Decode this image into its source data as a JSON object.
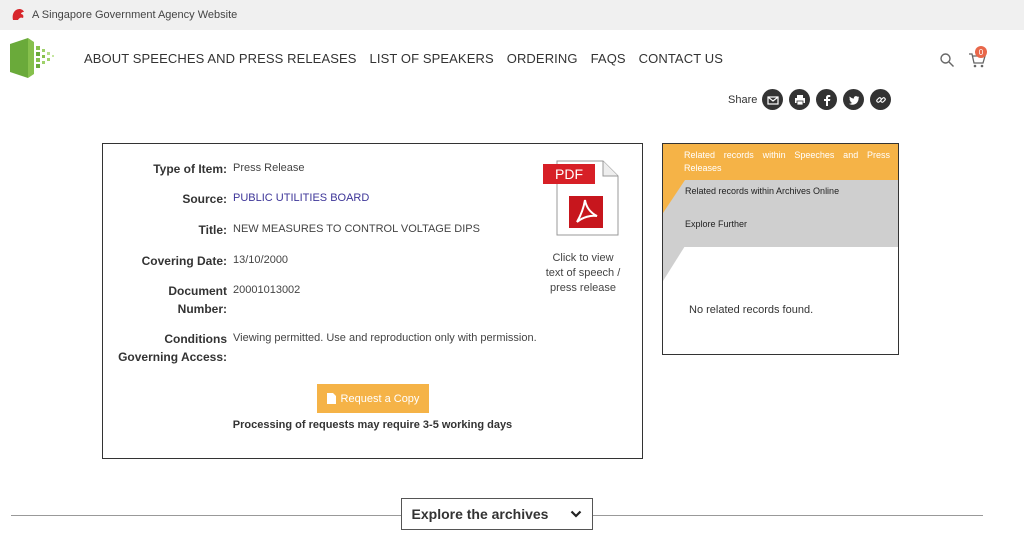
{
  "gov_banner": {
    "text": "A Singapore Government Agency Website",
    "icon": "lion-head-icon"
  },
  "nav": {
    "items": [
      {
        "label": "ABOUT SPEECHES AND PRESS RELEASES"
      },
      {
        "label": "LIST OF SPEAKERS"
      },
      {
        "label": "ORDERING"
      },
      {
        "label": "FAQS"
      },
      {
        "label": "CONTACT US"
      }
    ],
    "cart_count": "0"
  },
  "share": {
    "label": "Share",
    "buttons": [
      "email-icon",
      "print-icon",
      "facebook-icon",
      "twitter-icon",
      "link-icon"
    ]
  },
  "record": {
    "type_label": "Type of Item:",
    "type_value": "Press Release",
    "source_label": "Source:",
    "source_value": "PUBLIC UTILITIES BOARD",
    "title_label": "Title:",
    "title_value": "NEW MEASURES TO CONTROL VOLTAGE DIPS",
    "date_label": "Covering Date:",
    "date_value": "13/10/2000",
    "docnum_label_1": "Document",
    "docnum_label_2": "Number:",
    "docnum_value": "20001013002",
    "conditions_label_1": "Conditions",
    "conditions_label_2": "Governing Access:",
    "conditions_value": "Viewing permitted. Use and reproduction only with permission.",
    "pdf_badge": "PDF",
    "pdf_caption_1": "Click to view",
    "pdf_caption_2": "text of speech /",
    "pdf_caption_3": "press release",
    "request_label": "Request a Copy",
    "processing_note": "Processing of requests may require 3-5 working days"
  },
  "related": {
    "tab1": "Related records within Speeches and Press Releases",
    "tab2": "Related records within Archives Online",
    "tab3": "Explore Further",
    "empty": "No related records found."
  },
  "explore": {
    "label": "Explore the archives"
  },
  "colors": {
    "accent": "#f5b347",
    "link": "#3d3598",
    "badge": "#e8674a",
    "logo_green": "#6aaa3a"
  }
}
